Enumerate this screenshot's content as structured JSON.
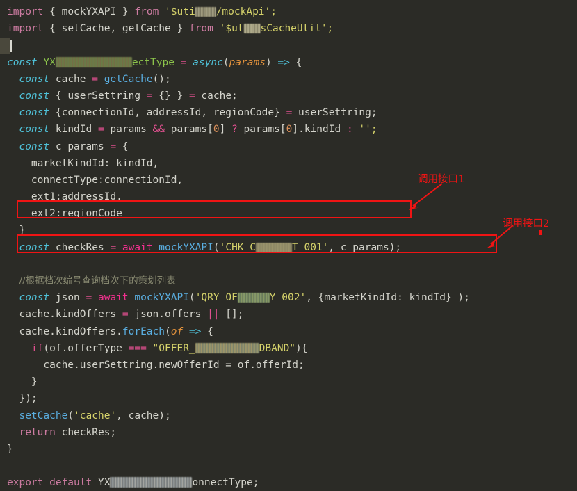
{
  "editor": {
    "background_color": "#2b2b26",
    "foreground_color": "#d4d4cc",
    "language": "javascript",
    "caret": {
      "line": 3,
      "column": 1
    }
  },
  "colors": {
    "keyword": "#cc7ba1",
    "const_keyword": "#4fc1d8",
    "string": "#d6d36b",
    "number": "#d98f5a",
    "function": "#5aaee0",
    "parameter": "#e0913c",
    "declaration": "#8bc34a",
    "operator": "#e0508f",
    "comment": "#7f8070",
    "annotation_red": "#f01414"
  },
  "code": {
    "line01": {
      "kw_import": "import",
      "brace_open": " { ",
      "ident": "mockYXAPI",
      "brace_close": " } ",
      "kw_from": "from",
      "str_start": " '$uti",
      "str_end": "/mockApi';"
    },
    "line02": {
      "kw_import": "import",
      "brace_open": " { ",
      "ident1": "setCache",
      "comma": ", ",
      "ident2": "getCache",
      "brace_close": " } ",
      "kw_from": "from",
      "str_start": " '$ut",
      "str_mid": "s/",
      "str_end": "sCacheUtil';"
    },
    "line04": {
      "kw_const": "const",
      "name_start": " YX",
      "name_end": "ectType",
      "eq": " = ",
      "async": "async",
      "paren_open": "(",
      "param": "params",
      "paren_close": ")",
      "arrow": " => ",
      "brace": "{"
    },
    "line05": {
      "kw_const": "const",
      "ident": " cache",
      "eq": " = ",
      "call": "getCache",
      "tail": "();"
    },
    "line06": {
      "kw_const": "const",
      "destructure": " { userSettring ",
      "eq1": "=",
      "empty": " {} } ",
      "eq2": "=",
      "tail": " cache;"
    },
    "line07": {
      "kw_const": "const",
      "destructure": " {connectionId, addressId, regionCode} ",
      "eq": "=",
      "tail": " userSettring;"
    },
    "line08": {
      "kw_const": "const",
      "ident": " kindId ",
      "eq": "=",
      "p1": " params ",
      "and": "&&",
      "p2": " params[",
      "n1": "0",
      "p3": "] ",
      "q": "?",
      "p4": " params[",
      "n2": "0",
      "p5": "].kindId ",
      "colon": ":",
      "p6": " '';"
    },
    "line09": {
      "kw_const": "const",
      "ident": " c_params ",
      "eq": "=",
      "brace": " {"
    },
    "line10": "marketKindId: kindId,",
    "line11": "connectType:connectionId,",
    "line12": "ext1:addressId,",
    "line13": "ext2:regionCode",
    "line14": "}",
    "line15": {
      "kw_const": "const",
      "ident": " checkRes ",
      "eq": "=",
      "await": " await",
      "call": " mockYXAPI",
      "paren": "(",
      "str_start": "'CHK_C",
      "str_end": "T_001'",
      "tail": ", c_params);"
    },
    "line17_comment": "//根据档次编号查询档次下的策划列表",
    "line18": {
      "kw_const": "const",
      "ident": " json ",
      "eq": "=",
      "await": " await",
      "call": " mockYXAPI",
      "paren": "(",
      "str_start": "'QRY_OF",
      "str_mid": "_",
      "str_end": "Y_002'",
      "tail": ", {marketKindId: kindId} );"
    },
    "line19": {
      "pre": "cache.kindOffers ",
      "eq": "=",
      "mid": " json.offers ",
      "or": "||",
      "tail": " [];"
    },
    "line20": {
      "pre": "cache.kindOffers.",
      "call": "forEach",
      "paren": "(",
      "param": "of",
      "arrow": " => ",
      "brace": "{"
    },
    "line21": {
      "kw_if": "if",
      "paren": "(of.offerType ",
      "eqeqeq": "===",
      "str_start": " \"OFFER_",
      "str_mid": "_",
      "str_end": "DBAND\"",
      "tail": "){"
    },
    "line22": "cache.userSettring.newOfferId = of.offerId;",
    "line23": "}",
    "line24": "});",
    "line25": {
      "call": "setCache",
      "paren": "(",
      "str": "'cache'",
      "tail": ", cache);"
    },
    "line26": {
      "kw_return": "return",
      "tail": " checkRes;"
    },
    "line27": "}",
    "line29": {
      "kw_export": "export",
      "kw_default": " default",
      "name_start": " YX",
      "name_end": "onnectType;"
    }
  },
  "annotations": [
    {
      "id": "annot-1",
      "label": "调用接口1",
      "target_line": "line15"
    },
    {
      "id": "annot-2",
      "label": "调用接口2",
      "target_line": "line18"
    }
  ]
}
